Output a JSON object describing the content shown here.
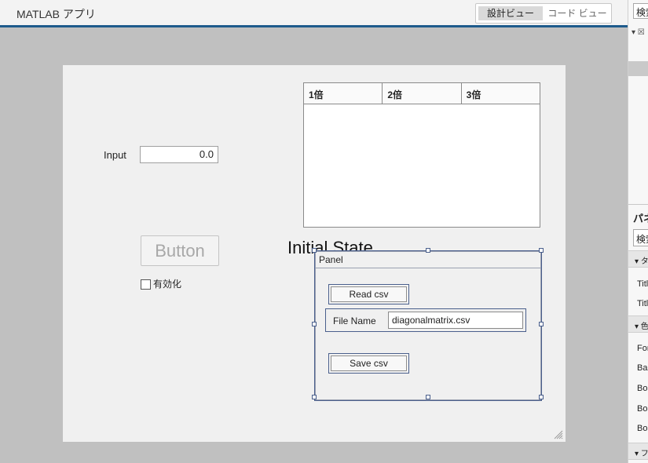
{
  "app": {
    "title": "MATLAB アプリ",
    "view_toggle": {
      "design": "設計ビュー",
      "code": "コード ビュー",
      "active": "design"
    }
  },
  "figure": {
    "input_label": "Input",
    "input_value": "0.0",
    "table_columns": [
      "1倍",
      "2倍",
      "3倍"
    ],
    "button_label": "Button",
    "checkbox_label": "有効化",
    "checkbox_checked": false,
    "state_label": "Initial State",
    "panel": {
      "title": "Panel",
      "read_button": "Read csv",
      "file_name_label": "File Name",
      "file_name_value": "diagonalmatrix.csv",
      "save_button": "Save csv"
    }
  },
  "right_pane": {
    "search_placeholder": "検索",
    "tree_row": "▾ ☒",
    "inspector_heading": "パネル",
    "inspector_search_placeholder": "検索",
    "section1": "▾ タイトル",
    "props1": [
      "Title",
      "TitlePosition"
    ],
    "section2": "▾ 色とスタイル",
    "props2": [
      "ForegroundColor",
      "BackgroundColor",
      "BorderType",
      "BorderColor",
      "BorderWidth"
    ],
    "section3": "▾ フォント"
  },
  "colors": {
    "header_accent": "#1e5b8c",
    "canvas_bg": "#c0c0c0",
    "figure_bg": "#f0f0f0",
    "selection": "#4a5f8c"
  }
}
